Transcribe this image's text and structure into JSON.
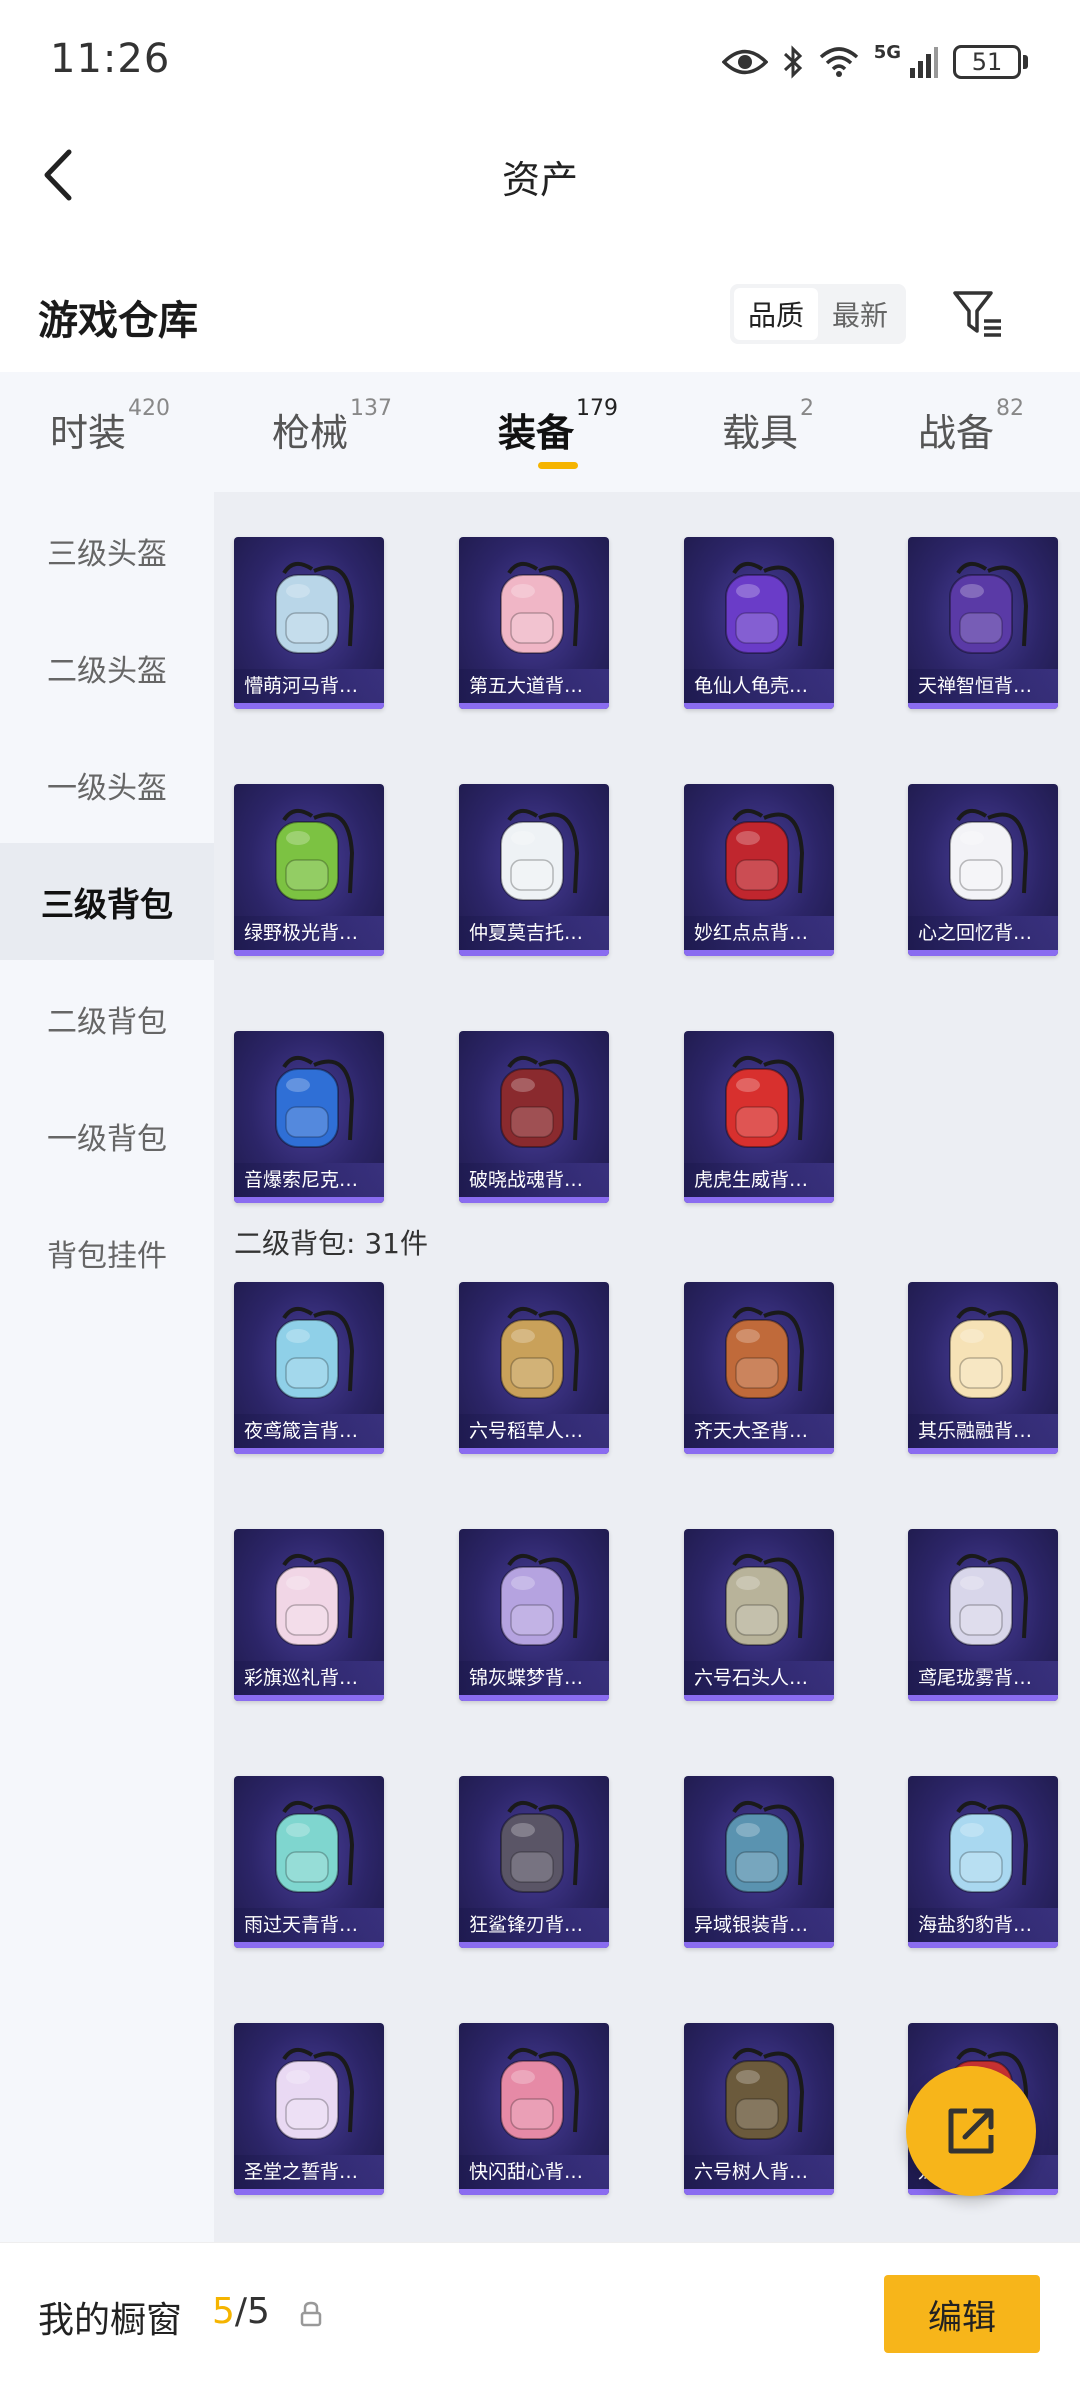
{
  "status": {
    "time": "11:26",
    "network": "5G",
    "battery": "51"
  },
  "nav": {
    "title": "资产"
  },
  "warehouse": {
    "title": "游戏仓库",
    "sort_options": [
      {
        "label": "品质",
        "active": true
      },
      {
        "label": "最新",
        "active": false
      }
    ]
  },
  "tabs": [
    {
      "label": "时装",
      "count": "420",
      "active": false
    },
    {
      "label": "枪械",
      "count": "137",
      "active": false
    },
    {
      "label": "装备",
      "count": "179",
      "active": true
    },
    {
      "label": "载具",
      "count": "2",
      "active": false
    },
    {
      "label": "战备",
      "count": "82",
      "active": false
    }
  ],
  "sidebar": [
    {
      "label": "三级头盔",
      "active": false
    },
    {
      "label": "二级头盔",
      "active": false
    },
    {
      "label": "一级头盔",
      "active": false
    },
    {
      "label": "三级背包",
      "active": true
    },
    {
      "label": "二级背包",
      "active": false
    },
    {
      "label": "一级背包",
      "active": false
    },
    {
      "label": "背包挂件",
      "active": false
    }
  ],
  "level3_items": [
    {
      "name": "懵萌河马背…",
      "color": "#b9d6e8"
    },
    {
      "name": "第五大道背…",
      "color": "#f0b6c6"
    },
    {
      "name": "龟仙人龟壳…",
      "color": "#6a3cc8"
    },
    {
      "name": "天禅智恒背…",
      "color": "#5a3aa6"
    },
    {
      "name": "绿野极光背…",
      "color": "#7cc242"
    },
    {
      "name": "仲夏莫吉托…",
      "color": "#eef2f5"
    },
    {
      "name": "妙红点点背…",
      "color": "#c0262e"
    },
    {
      "name": "心之回忆背…",
      "color": "#f3f3f7"
    },
    {
      "name": "音爆索尼克…",
      "color": "#2f6fd6"
    },
    {
      "name": "破晓战魂背…",
      "color": "#8a2a2e"
    },
    {
      "name": "虎虎生威背…",
      "color": "#d8302e"
    }
  ],
  "section2": {
    "label": "二级背包: 31件"
  },
  "level2_items": [
    {
      "name": "夜鸢箴言背…",
      "color": "#8fd0e8"
    },
    {
      "name": "六号稻草人…",
      "color": "#c9a15a"
    },
    {
      "name": "齐天大圣背…",
      "color": "#c06a3a"
    },
    {
      "name": "其乐融融背…",
      "color": "#f6e2b6"
    },
    {
      "name": "彩旗巡礼背…",
      "color": "#f1d6e6"
    },
    {
      "name": "锦灰蝶梦背…",
      "color": "#b5a3e0"
    },
    {
      "name": "六号石头人…",
      "color": "#b8b39a"
    },
    {
      "name": "鸢尾珑雾背…",
      "color": "#d8d6ea"
    },
    {
      "name": "雨过天青背…",
      "color": "#7fd6cf"
    },
    {
      "name": "狂鲨锋刃背…",
      "color": "#5a5566"
    },
    {
      "name": "异域银装背…",
      "color": "#5a93b0"
    },
    {
      "name": "海盐豹豹背…",
      "color": "#a9d8f0"
    },
    {
      "name": "圣堂之誓背…",
      "color": "#e9d9f3"
    },
    {
      "name": "快闪甜心背…",
      "color": "#e68aa6"
    },
    {
      "name": "六号树人背…",
      "color": "#6b5a3c"
    },
    {
      "name": "龙…背…",
      "color": "#c83232"
    }
  ],
  "bottom": {
    "showcase_label": "我的橱窗",
    "showcase_used": "5",
    "showcase_total": "/5",
    "edit_label": "编辑"
  }
}
